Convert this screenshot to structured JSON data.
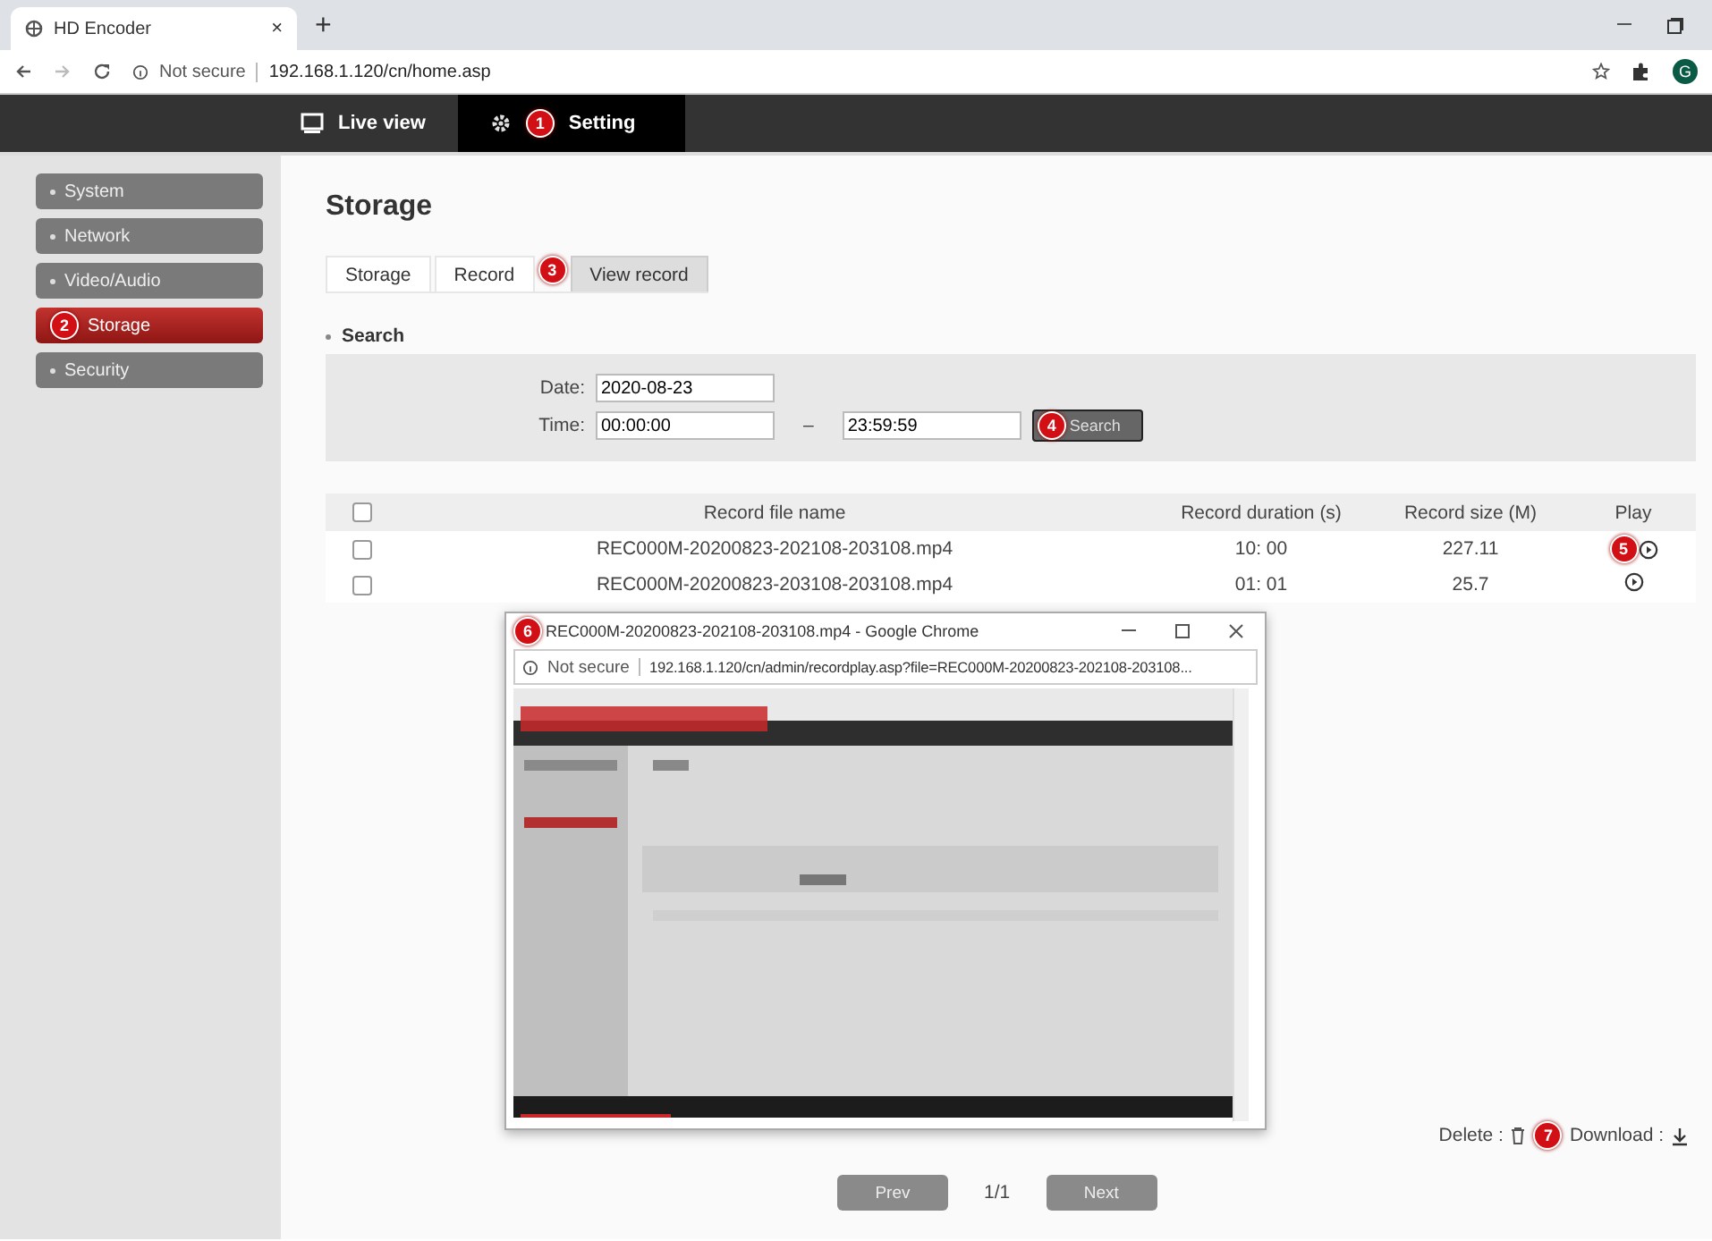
{
  "browser": {
    "tab_title": "HD Encoder",
    "tab_close": "×",
    "new_tab": "+",
    "security": "Not secure",
    "url": "192.168.1.120/cn/home.asp",
    "avatar": "G"
  },
  "nav": [
    {
      "label": "Live view",
      "kind": "monitor",
      "selected": false
    },
    {
      "label": "Setting",
      "kind": "gear",
      "selected": true,
      "badge": "1"
    }
  ],
  "sidebar": {
    "items": [
      {
        "label": "System",
        "selected": false
      },
      {
        "label": "Network",
        "selected": false
      },
      {
        "label": "Video/Audio",
        "selected": false
      },
      {
        "label": "Storage",
        "selected": true,
        "badge": "2"
      },
      {
        "label": "Security",
        "selected": false
      }
    ]
  },
  "page_title": "Storage",
  "tabs": [
    {
      "label": "Storage",
      "selected": false
    },
    {
      "label": "Record",
      "selected": false
    },
    {
      "label": "View record",
      "selected": true,
      "badge": "3"
    }
  ],
  "search": {
    "heading": "Search",
    "date_label": "Date:",
    "date": "2020-08-23",
    "time_label": "Time:",
    "time_from": "00:00:00",
    "separator": "–",
    "time_to": "23:59:59",
    "button": "Search",
    "badge": "4"
  },
  "table": {
    "header_checked": false,
    "columns": [
      "Record file name",
      "Record duration (s)",
      "Record size (M)",
      "Play"
    ],
    "rows": [
      {
        "checked": false,
        "file": "REC000M-20200823-202108-203108.mp4",
        "duration": "10: 00",
        "size": "227.11",
        "badge": "5"
      },
      {
        "checked": false,
        "file": "REC000M-20200823-203108-203108.mp4",
        "duration": "01: 01",
        "size": "25.7"
      }
    ]
  },
  "popup": {
    "badge": "6",
    "title": "REC000M-20200823-202108-203108.mp4 - Google Chrome",
    "security": "Not secure",
    "url": "192.168.1.120/cn/admin/recordplay.asp?file=REC000M-20200823-202108-203108..."
  },
  "actions": {
    "delete_label": "Delete :",
    "badge": "7",
    "download_label": "Download :"
  },
  "pager": {
    "prev": "Prev",
    "page": "1/1",
    "next": "Next"
  }
}
